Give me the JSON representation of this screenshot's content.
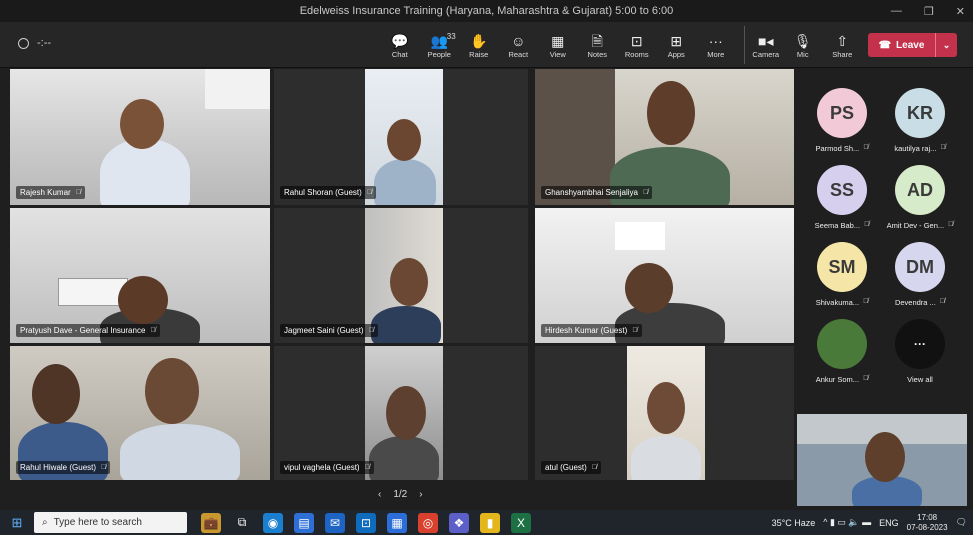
{
  "window": {
    "title": "Edelweiss Insurance Training (Haryana, Maharashtra & Gujarat) 5:00 to 6:00",
    "min": "—",
    "max": "❐",
    "close": "✕"
  },
  "toolbar": {
    "timer_text": "-:--",
    "tools": [
      {
        "icon": "💬",
        "label": "Chat",
        "name": "chat"
      },
      {
        "icon": "👥",
        "label": "People",
        "name": "people",
        "count": "33"
      },
      {
        "icon": "✋",
        "label": "Raise",
        "name": "raise"
      },
      {
        "icon": "☺",
        "label": "React",
        "name": "react"
      },
      {
        "icon": "▦",
        "label": "View",
        "name": "view"
      },
      {
        "icon": "🗎",
        "label": "Notes",
        "name": "notes"
      },
      {
        "icon": "⊡",
        "label": "Rooms",
        "name": "rooms"
      },
      {
        "icon": "⊞",
        "label": "Apps",
        "name": "apps"
      },
      {
        "icon": "···",
        "label": "More",
        "name": "more"
      },
      {
        "icon": "■◂",
        "label": "Camera",
        "name": "camera"
      },
      {
        "icon": "🎙",
        "label": "Mic",
        "name": "mic"
      },
      {
        "icon": "⇧",
        "label": "Share",
        "name": "share"
      }
    ],
    "leave_label": "Leave",
    "leave_icon": "☎",
    "chevron": "⌄"
  },
  "tiles": [
    {
      "name": "Rajesh Kumar"
    },
    {
      "name": "Rahul Shoran (Guest)"
    },
    {
      "name": "Ghanshyambhai Senjaliya"
    },
    {
      "name": "Pratyush Dave - General Insurance"
    },
    {
      "name": "Jagmeet Saini (Guest)"
    },
    {
      "name": "Hirdesh Kumar (Guest)"
    },
    {
      "name": "Rahul Hiwale (Guest)"
    },
    {
      "name": "vipul vaghela (Guest)"
    },
    {
      "name": "atul (Guest)"
    }
  ],
  "pager": {
    "prev": "‹",
    "text": "1/2",
    "next": "›"
  },
  "side_participants": [
    {
      "initials": "PS",
      "label": "Parmod Sh...",
      "color": "#f2c9d6"
    },
    {
      "initials": "KR",
      "label": "kautilya raj...",
      "color": "#c9dde6"
    },
    {
      "initials": "SS",
      "label": "Seema Bab...",
      "color": "#d6d0ee"
    },
    {
      "initials": "AD",
      "label": "Amit Dev - Gen...",
      "color": "#d6ebc9"
    },
    {
      "initials": "SM",
      "label": "Shivakuma...",
      "color": "#f5e6a8"
    },
    {
      "initials": "DM",
      "label": "Devendra ...",
      "color": "#d6d6ee"
    },
    {
      "initials": "",
      "label": "Ankur Som...",
      "color": "#4a7a3a"
    },
    {
      "initials": "···",
      "label": "View all",
      "color": "#111111"
    }
  ],
  "mic_off": "🎙̸",
  "taskbar": {
    "start": "⊞",
    "search_icon": "⌕",
    "search_placeholder": "Type here to search",
    "apps": [
      {
        "icon": "💼",
        "name": "briefcase",
        "bg": "#c8972e"
      },
      {
        "icon": "⧉",
        "name": "task-view",
        "bg": "transparent"
      },
      {
        "icon": "◉",
        "name": "edge",
        "bg": "#1b7fd0"
      },
      {
        "icon": "▤",
        "name": "news",
        "bg": "#2e6fd6"
      },
      {
        "icon": "✉",
        "name": "mail",
        "bg": "#1d64c4"
      },
      {
        "icon": "⊡",
        "name": "outlook",
        "bg": "#0f6cbd"
      },
      {
        "icon": "▦",
        "name": "calendar",
        "bg": "#2b6ed8"
      },
      {
        "icon": "◎",
        "name": "chrome",
        "bg": "#d9412e"
      },
      {
        "icon": "❖",
        "name": "teams",
        "bg": "#5b5fc7"
      },
      {
        "icon": "▮",
        "name": "sticky",
        "bg": "#e3b71c"
      },
      {
        "icon": "X",
        "name": "excel",
        "bg": "#1d7044"
      }
    ],
    "weather": "35°C  Haze",
    "tray_icons": "^  ▮ ▭ 🔈 ▬",
    "lang": "ENG",
    "time": "17:08",
    "date": "07-08-2023",
    "notif": "🗨"
  }
}
